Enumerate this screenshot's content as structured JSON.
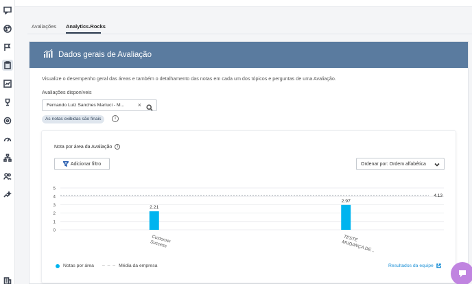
{
  "sidebar": {
    "items": [
      {
        "icon": "chat-icon"
      },
      {
        "icon": "palette-icon"
      },
      {
        "icon": "flag-icon"
      },
      {
        "icon": "clipboard-icon",
        "active": true
      },
      {
        "icon": "chart-box-icon"
      },
      {
        "icon": "trophy-icon"
      },
      {
        "icon": "target-icon"
      },
      {
        "icon": "gauge-icon"
      },
      {
        "icon": "org-chart-icon"
      },
      {
        "icon": "users-icon"
      },
      {
        "icon": "sparkle-icon"
      },
      {
        "icon": "building-icon"
      }
    ]
  },
  "tabs": [
    {
      "label": "Avaliações",
      "active": false
    },
    {
      "label": "Analytics.Rocks",
      "active": true
    }
  ],
  "header": {
    "title": "Dados gerais de Avaliação",
    "color": "#5a7b9f"
  },
  "description": "Visualize o desempenho geral das áreas e também o detalhamento das notas em cada um dos tópicos e perguntas de uma Avaliação.",
  "available": {
    "label": "Avaliações disponíveis",
    "selected": "Fernando Luiz Sanches Martuci - M...",
    "clear_symbol": "×"
  },
  "badge": {
    "text": "As notas exibidas são finais",
    "info": "i"
  },
  "panel": {
    "title": "Nota por área da Avaliação",
    "info": "i",
    "filter_label": "Adicionar filtro",
    "sort_label": "Ordenar por: Ordem alfabética"
  },
  "chart_data": {
    "type": "bar",
    "categories": [
      "Customer Success",
      "TESTE MUDANÇA DE..."
    ],
    "category_lines": [
      [
        "Customer",
        "Success"
      ],
      [
        "TESTE",
        "MUDANÇA DE..."
      ]
    ],
    "values": [
      2.21,
      2.97
    ],
    "value_labels": [
      "2.21",
      "2.97"
    ],
    "reference_line": {
      "value": 4.13,
      "label": "4.13"
    },
    "yticks": [
      0,
      1,
      2,
      3,
      4,
      5
    ],
    "ylim": [
      0,
      5
    ],
    "bar_color": "#00b4ef",
    "grid": true
  },
  "legend": {
    "series_label": "Notas por área",
    "dash_symbol": "– – –",
    "reference_label": "Média da empresa"
  },
  "team_link": "Resultados da equipe"
}
